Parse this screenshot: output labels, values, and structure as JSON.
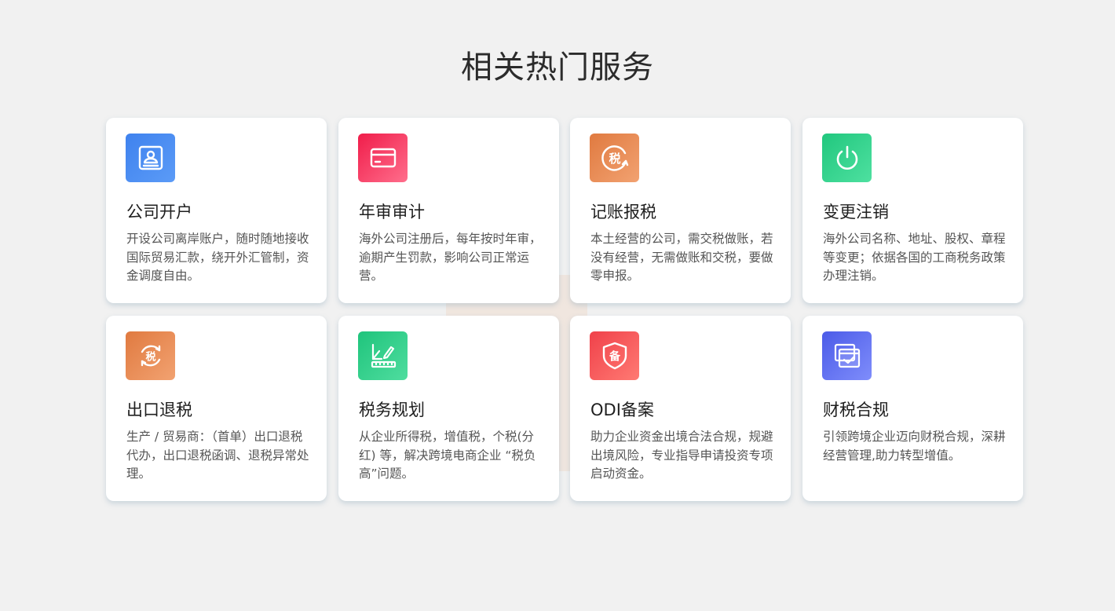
{
  "section": {
    "title": "相关热门服务"
  },
  "cards": [
    {
      "title": "公司开户",
      "desc": "开设公司离岸账户，随时随地接收国际贸易汇款，绕开外汇管制，资金调度自由。",
      "icon": "contact-card-icon",
      "color_from": "#3f82ee",
      "color_to": "#5b9bf7"
    },
    {
      "title": "年审审计",
      "desc": "海外公司注册后，每年按时年审，逾期产生罚款，影响公司正常运营。",
      "icon": "credit-card-icon",
      "color_from": "#f01d4a",
      "color_to": "#ff6e8c"
    },
    {
      "title": "记账报税",
      "desc": "本土经营的公司，需交税做账，若没有经营，无需做账和交税，要做零申报。",
      "icon": "tax-icon",
      "icon_text": "税",
      "color_from": "#e07a40",
      "color_to": "#f2a271"
    },
    {
      "title": "变更注销",
      "desc": "海外公司名称、地址、股权、章程等变更；依据各国的工商税务政策办理注销。",
      "icon": "power-icon",
      "color_from": "#21c77e",
      "color_to": "#4ee0a0"
    },
    {
      "title": "出口退税",
      "desc": "生产 / 贸易商：（首单）出口退税代办，出口退税函调、退税异常处理。",
      "icon": "tax-refund-icon",
      "icon_text": "税",
      "color_from": "#e07a40",
      "color_to": "#f2a271"
    },
    {
      "title": "税务规划",
      "desc": "从企业所得税，增值税，个税(分红) 等，解决跨境电商企业 “税负高”问题。",
      "icon": "planning-ruler-icon",
      "color_from": "#1fc47c",
      "color_to": "#4fdd9f"
    },
    {
      "title": "ODI备案",
      "desc": "助力企业资金出境合法合规，规避出境风险，专业指导申请投资专项启动资金。",
      "icon": "shield-filing-icon",
      "icon_text": "备",
      "color_from": "#f0414a",
      "color_to": "#ff7a73"
    },
    {
      "title": "财税合规",
      "desc": "引领跨境企业迈向财税合规，深耕经营管理,助力转型增值。",
      "icon": "checklist-icon",
      "color_from": "#4b5be8",
      "color_to": "#7f8dfb"
    }
  ]
}
